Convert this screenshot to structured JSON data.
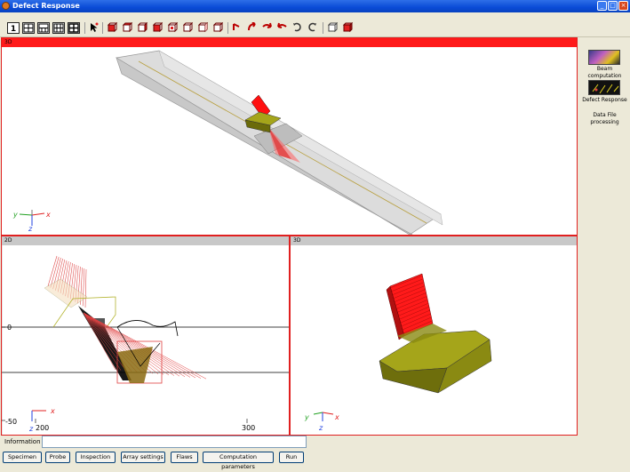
{
  "window": {
    "title": "Defect Response",
    "minimize": "_",
    "maximize": "□",
    "close": "×"
  },
  "side_panel": {
    "items": [
      {
        "label": "Beam computation",
        "icon": "beam-computation-icon"
      },
      {
        "label": "Defect Response",
        "icon": "defect-response-icon"
      },
      {
        "label": "Data File processing"
      }
    ]
  },
  "views": {
    "top": {
      "header": "3D"
    },
    "bottom_left": {
      "header": "2D",
      "axis_labels": {
        "zero": "0",
        "minus50": "-50",
        "x200": "200",
        "x300": "300"
      }
    },
    "bottom_right": {
      "header": "3D"
    }
  },
  "axes_triad": {
    "x": "x",
    "y": "y",
    "z": "z"
  },
  "info": {
    "label": "Information :",
    "value": ""
  },
  "buttons": [
    "Specimen",
    "Probe",
    "Inspection",
    "Array settings",
    "Flaws",
    "Computation parameters",
    "Run"
  ],
  "colors": {
    "accent_red": "#ff1a1a",
    "probe_olive": "#8a8a0a",
    "beam_red": "#e03030"
  }
}
